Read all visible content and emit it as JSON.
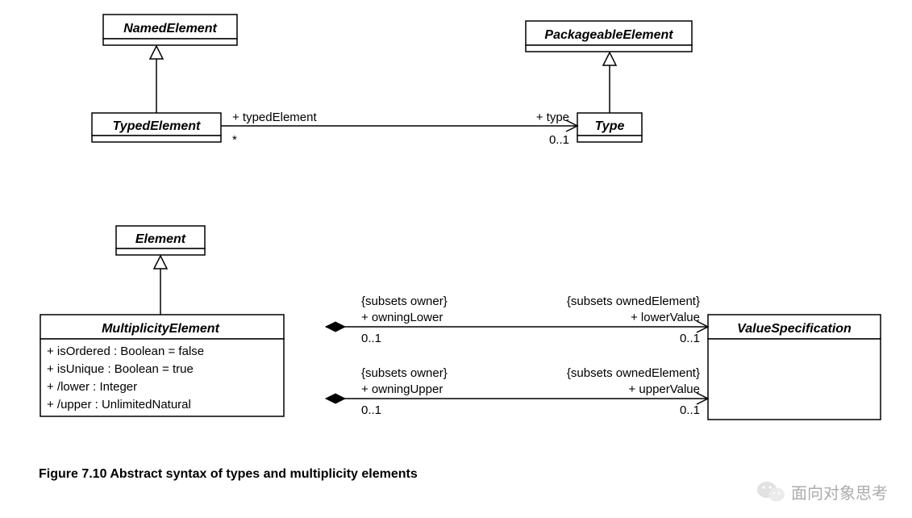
{
  "classes": {
    "NamedElement": {
      "name": "NamedElement",
      "abstract": true
    },
    "TypedElement": {
      "name": "TypedElement",
      "abstract": true
    },
    "PackageableElement": {
      "name": "PackageableElement",
      "abstract": true
    },
    "Type": {
      "name": "Type",
      "abstract": true
    },
    "Element": {
      "name": "Element",
      "abstract": true
    },
    "MultiplicityElement": {
      "name": "MultiplicityElement",
      "abstract": true,
      "attrs": [
        "+ isOrdered : Boolean = false",
        "+ isUnique : Boolean = true",
        "+ /lower : Integer",
        "+ /upper : UnlimitedNatural"
      ]
    },
    "ValueSpecification": {
      "name": "ValueSpecification",
      "abstract": true
    }
  },
  "assoc": {
    "typedElement_type": {
      "end1": {
        "role": "+ typedElement",
        "mult": "*"
      },
      "end2": {
        "role": "+ type",
        "mult": "0..1"
      },
      "navigableTo": "end2"
    },
    "owningLower_lowerValue": {
      "end1": {
        "constraint": "{subsets owner}",
        "role": "+ owningLower",
        "mult": "0..1",
        "agg": "composite"
      },
      "end2": {
        "constraint": "{subsets ownedElement}",
        "role": "+ lowerValue",
        "mult": "0..1"
      },
      "navigableTo": "end2"
    },
    "owningUpper_upperValue": {
      "end1": {
        "constraint": "{subsets owner}",
        "role": "+ owningUpper",
        "mult": "0..1",
        "agg": "composite"
      },
      "end2": {
        "constraint": "{subsets ownedElement}",
        "role": "+ upperValue",
        "mult": "0..1"
      },
      "navigableTo": "end2"
    }
  },
  "generalizations": [
    {
      "child": "TypedElement",
      "parent": "NamedElement"
    },
    {
      "child": "Type",
      "parent": "PackageableElement"
    },
    {
      "child": "MultiplicityElement",
      "parent": "Element"
    }
  ],
  "caption": "Figure 7.10  Abstract syntax of types and multiplicity elements",
  "watermark": "面向对象思考"
}
